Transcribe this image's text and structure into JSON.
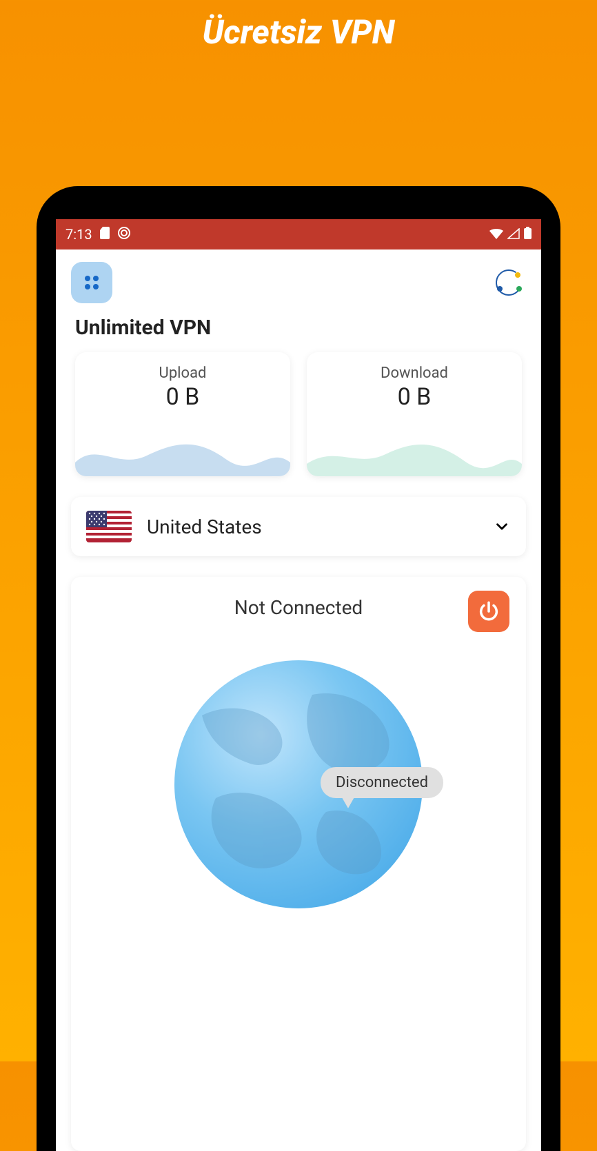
{
  "banner": {
    "title": "Ücretsiz VPN"
  },
  "statusbar": {
    "time": "7:13"
  },
  "app": {
    "title": "Unlimited VPN"
  },
  "stats": {
    "upload": {
      "label": "Upload",
      "value": "0 B"
    },
    "download": {
      "label": "Download",
      "value": "0 B"
    }
  },
  "server": {
    "selected": "United States"
  },
  "connection": {
    "status": "Not Connected",
    "bubble": "Disconnected"
  },
  "colors": {
    "accent": "#f26b3c",
    "statusbar": "#c0392b",
    "upload_wave": "#c7ddf0",
    "download_wave": "#d4f0e6"
  }
}
